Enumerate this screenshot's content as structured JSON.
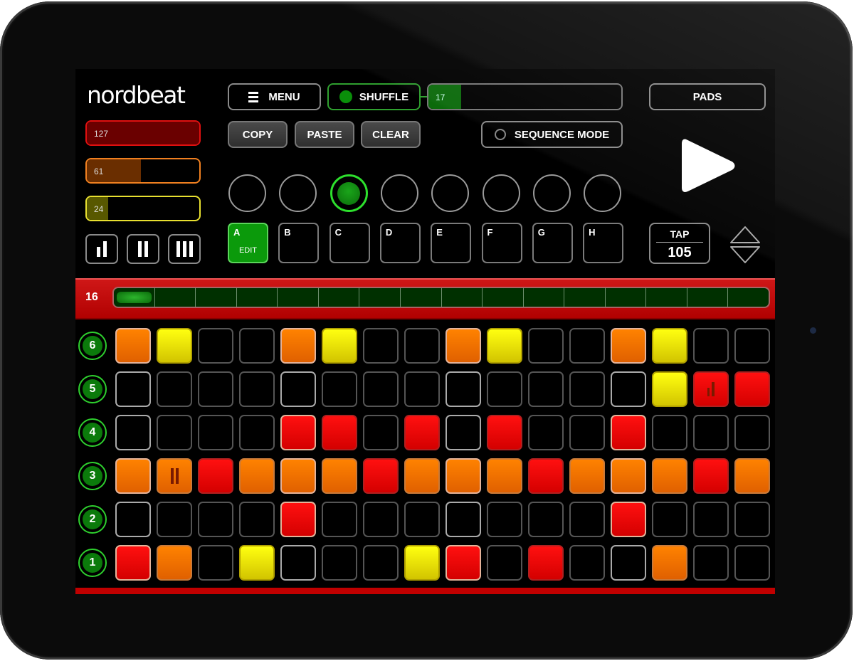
{
  "app": {
    "logo": "nordbeat"
  },
  "velocity_sliders": [
    {
      "value": "127",
      "fraction": 1.0,
      "color": "#e01010",
      "fill": "#6a0000"
    },
    {
      "value": "61",
      "fraction": 0.48,
      "color": "#f08020",
      "fill": "#6a2e00"
    },
    {
      "value": "24",
      "fraction": 0.19,
      "color": "#e8e030",
      "fill": "#585800"
    }
  ],
  "length_buttons": [
    {
      "name": "short",
      "bars": 1
    },
    {
      "name": "medium",
      "bars": 2
    },
    {
      "name": "long",
      "bars": 3
    }
  ],
  "toolbar": {
    "menu_label": "MENU",
    "shuffle_label": "SHUFFLE",
    "shuffle_on": true,
    "shuffle_value": "17",
    "shuffle_fraction": 0.17,
    "copy_label": "COPY",
    "paste_label": "PASTE",
    "clear_label": "CLEAR",
    "sequence_mode_label": "SEQUENCE MODE",
    "sequence_mode_on": false,
    "pads_label": "PADS"
  },
  "pattern_circles": {
    "count": 8,
    "active_index": 2
  },
  "patterns": [
    {
      "letter": "A",
      "sub": "EDIT",
      "active": true
    },
    {
      "letter": "B"
    },
    {
      "letter": "C"
    },
    {
      "letter": "D"
    },
    {
      "letter": "E"
    },
    {
      "letter": "F"
    },
    {
      "letter": "G"
    },
    {
      "letter": "H"
    }
  ],
  "tempo": {
    "tap_label": "TAP",
    "bpm": "105"
  },
  "steps": {
    "count": "16",
    "current_step": 1,
    "segments": 16
  },
  "colors": {
    "accent_green": "#2ed02e",
    "red": "#ff1010",
    "orange": "#ff8200",
    "yellow": "#ffff10"
  },
  "grid": {
    "rows": [
      {
        "label": "6",
        "cells": [
          "O",
          "Y",
          "",
          "",
          "O",
          "Y",
          "",
          "",
          "O",
          "Y",
          "",
          "",
          "O",
          "Y",
          "",
          ""
        ]
      },
      {
        "label": "5",
        "cells": [
          "",
          "",
          "",
          "",
          "",
          "",
          "",
          "",
          "",
          "",
          "",
          "",
          "",
          "Y",
          "R:flam1",
          "R"
        ]
      },
      {
        "label": "4",
        "cells": [
          "",
          "",
          "",
          "",
          "R",
          "R",
          "",
          "R",
          "",
          "R",
          "",
          "",
          "R",
          "",
          "",
          ""
        ]
      },
      {
        "label": "3",
        "cells": [
          "O",
          "O:flam2",
          "R",
          "O",
          "O",
          "O",
          "R",
          "O",
          "O",
          "O",
          "R",
          "O",
          "O",
          "O",
          "R",
          "O"
        ]
      },
      {
        "label": "2",
        "cells": [
          "",
          "",
          "",
          "",
          "R",
          "",
          "",
          "",
          "",
          "",
          "",
          "",
          "R",
          "",
          "",
          ""
        ]
      },
      {
        "label": "1",
        "cells": [
          "R",
          "O",
          "",
          "Y",
          "",
          "",
          "",
          "Y",
          "R",
          "",
          "R",
          "",
          "",
          "O",
          "",
          ""
        ]
      }
    ]
  }
}
